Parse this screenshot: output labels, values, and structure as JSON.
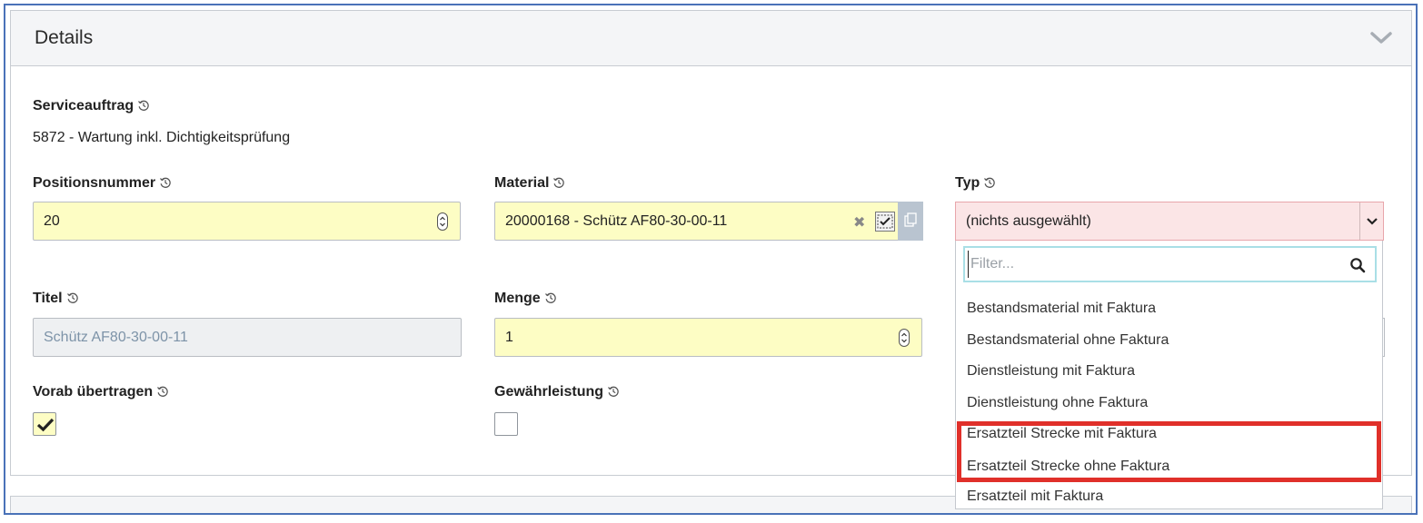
{
  "panel": {
    "title": "Details"
  },
  "serviceauftrag": {
    "label": "Serviceauftrag",
    "value": "5872 - Wartung inkl. Dichtigkeitsprüfung"
  },
  "positionsnummer": {
    "label": "Positionsnummer",
    "value": "20"
  },
  "material": {
    "label": "Material",
    "value": "20000168 - Schütz AF80-30-00-11",
    "clear": "✖"
  },
  "typ": {
    "label": "Typ",
    "selected": "(nichts ausgewählt)",
    "filter_placeholder": "Filter...",
    "options": [
      "Bestandsmaterial mit Faktura",
      "Bestandsmaterial ohne Faktura",
      "Dienstleistung mit Faktura",
      "Dienstleistung ohne Faktura",
      "Ersatzteil Strecke mit Faktura",
      "Ersatzteil Strecke ohne Faktura",
      "Ersatzteil mit Faktura"
    ]
  },
  "titel": {
    "label": "Titel",
    "value": "Schütz AF80-30-00-11"
  },
  "menge": {
    "label": "Menge",
    "value": "1"
  },
  "vorab": {
    "label": "Vorab übertragen",
    "checked": true
  },
  "gewaehrleistung": {
    "label": "Gewährleistung",
    "checked": false
  },
  "colors": {
    "highlight": "#e0302a",
    "required_bg": "#fdfdc4",
    "invalid_bg": "#fbe5e6"
  }
}
